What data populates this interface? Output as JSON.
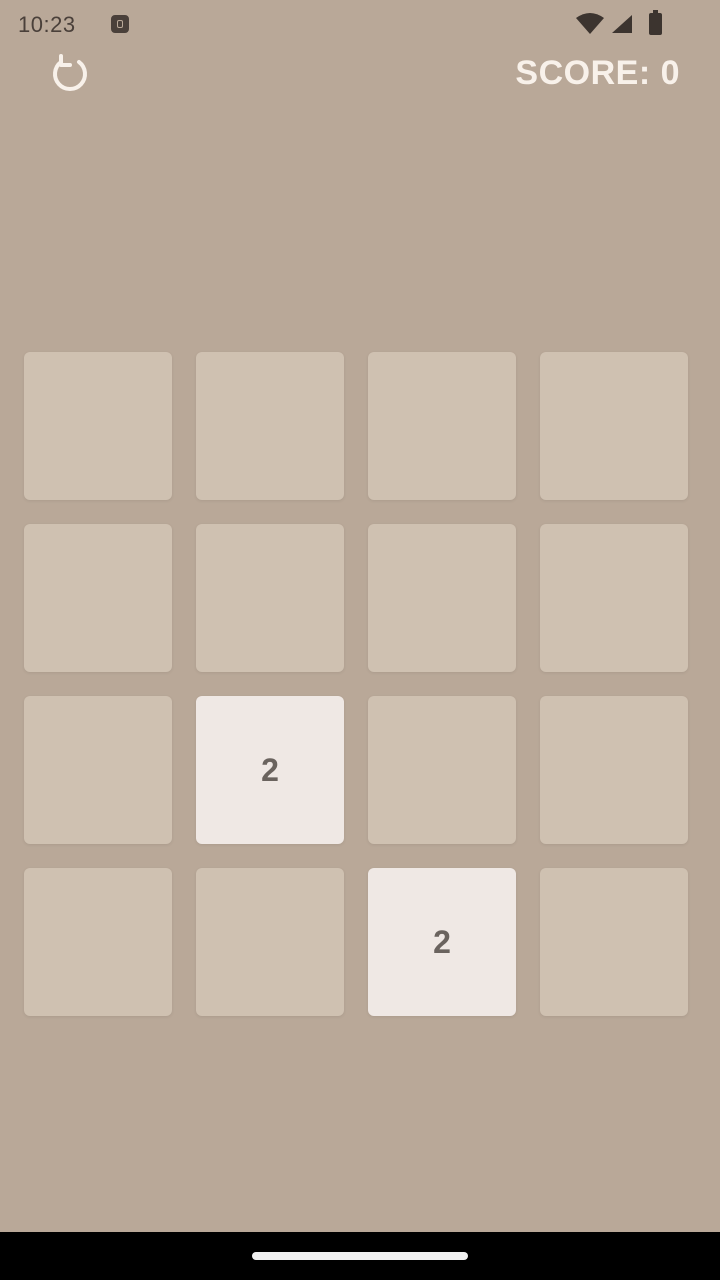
{
  "status_bar": {
    "time": "10:23",
    "icons": [
      "notification-icon",
      "wifi-icon",
      "signal-icon",
      "battery-icon"
    ]
  },
  "header": {
    "restart_icon": "restart-icon",
    "score_label": "SCORE: 0"
  },
  "board": {
    "size": 4,
    "cells": [
      [
        "",
        "",
        "",
        ""
      ],
      [
        "",
        "",
        "",
        ""
      ],
      [
        "",
        "2",
        "",
        ""
      ],
      [
        "",
        "",
        "2",
        ""
      ]
    ]
  },
  "colors": {
    "background": "#b9a898",
    "empty_tile": "#cfc1b1",
    "tile_2": "#efe8e4",
    "score_text": "#f8f1ea"
  }
}
